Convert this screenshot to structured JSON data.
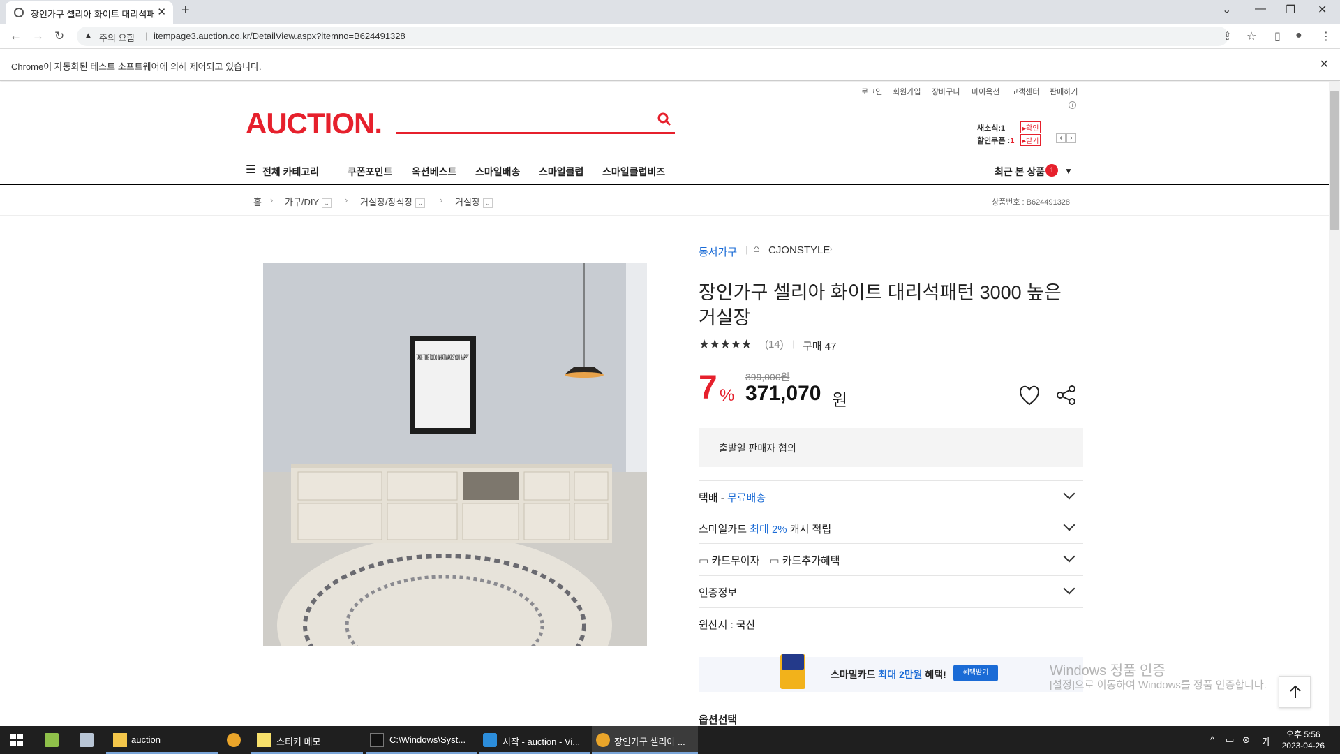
{
  "browser": {
    "tab_title": "장인가구 셀리아 화이트 대리석패턴 3000 높은 거실장",
    "warning_label": "주의 요함",
    "url": "itempage3.auction.co.kr/DetailView.aspx?itemno=B624491328",
    "infobar_message": "Chrome이 자동화된 테스트 소프트웨어에 의해 제어되고 있습니다."
  },
  "site": {
    "top_links": [
      "로그인",
      "회원가입",
      "장바구니",
      "마이옥션",
      "고객센터",
      "판매하기"
    ],
    "logo": "AUCTION.",
    "new_label": "새소식:",
    "new_count": "1",
    "new_btn": "확인",
    "coupon_label": "할인쿠폰 :",
    "coupon_count": "1",
    "coupon_btn": "받기"
  },
  "nav": {
    "all_category": "전체 카테고리",
    "items": [
      "쿠폰포인트",
      "옥션베스트",
      "스마일배송",
      "스마일클럽",
      "스마일클럽비즈"
    ],
    "recent": "최근 본 상품",
    "recent_count": "1"
  },
  "breadcrumb": {
    "home": "홈",
    "items": [
      "가구/DIY",
      "거실장/장식장",
      "거실장"
    ],
    "product_no": "상품번호 : B624491328"
  },
  "product": {
    "seller": "동서가구",
    "store": "CJONSTYLE",
    "title": "장인가구 셀리아 화이트 대리석패턴 3000 높은 거실장",
    "rating": 4.5,
    "stars_text": "★★★★★",
    "reviews": "(14)",
    "purchase": "구매 47",
    "discount": "7",
    "discount_unit": "%",
    "original_price": "399,000원",
    "price": "371,070",
    "price_unit": "원",
    "ship_notice": "출발일 판매자 협의",
    "delivery_prefix": "택배 - ",
    "delivery_value": "무료배송",
    "smilecard_prefix": "스마일카드 ",
    "smilecard_value": "최대 2%",
    "smilecard_suffix": " 캐시 적립",
    "card_interest": "카드무이자",
    "card_benefit": "카드추가혜택",
    "certification": "인증정보",
    "origin": "원산지 : 국산",
    "banner_prefix": "스마일카드 ",
    "banner_value": "최대 2만원",
    "banner_suffix": " 혜택!",
    "banner_btn": "혜택받기",
    "option_select": "옵션선택",
    "poster_text": "TAKE TIME TO DO WHAT MAKES YOU HAPPY"
  },
  "watermark": {
    "line1": "Windows 정품 인증",
    "line2": "[설정]으로 이동하여 Windows를 정품 인증합니다."
  },
  "taskbar": {
    "items": [
      "auction",
      "스티커 메모",
      "C:\\Windows\\Syst...",
      "시작 - auction - Vi...",
      "장인가구 셀리아 ..."
    ],
    "time": "오후 5:56",
    "date": "2023-04-26"
  },
  "colors": {
    "brand": "#e6202c",
    "link": "#1a6bd6"
  }
}
